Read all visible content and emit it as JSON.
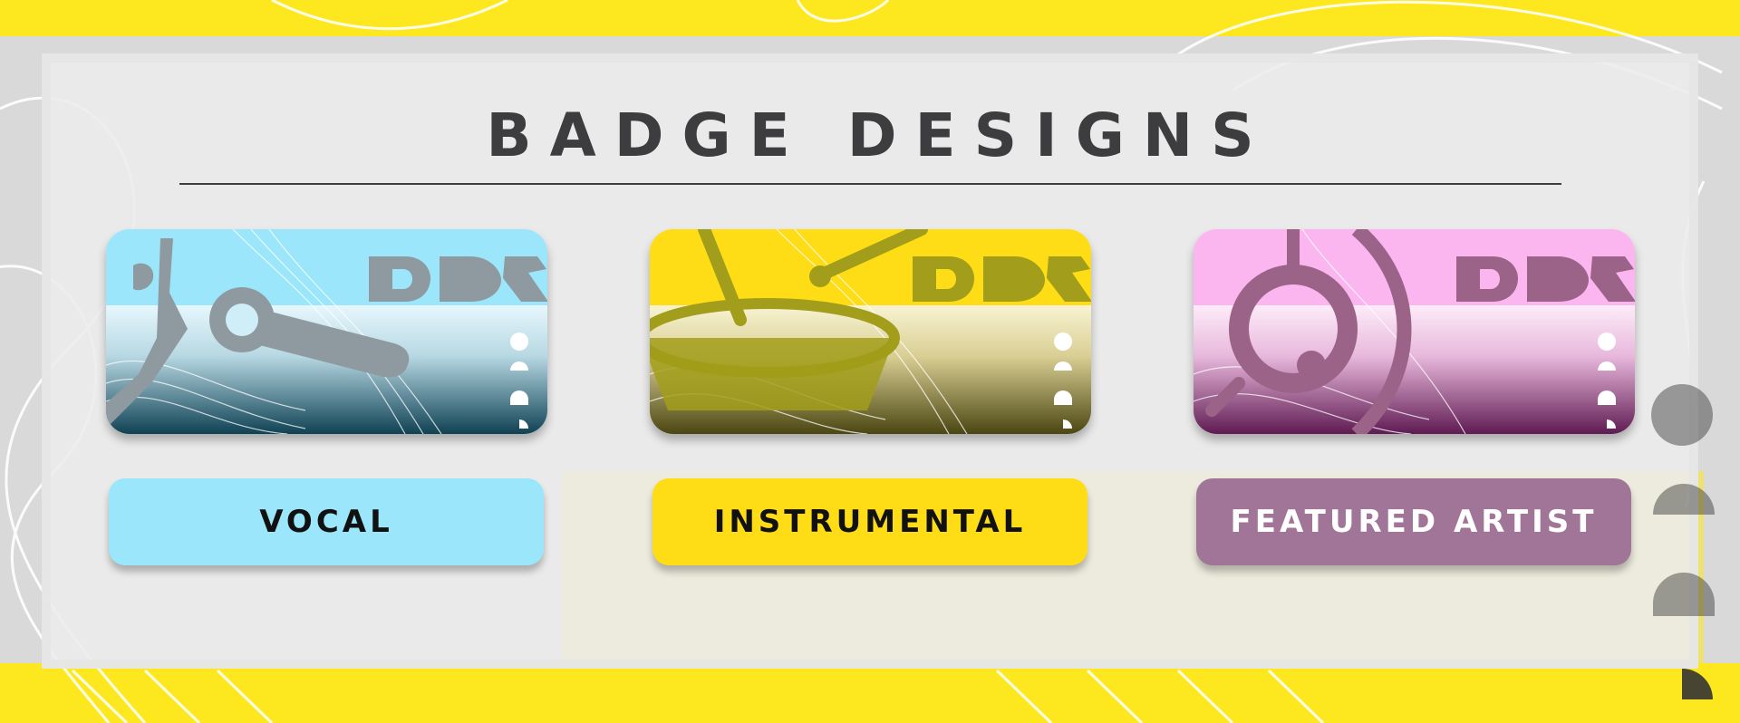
{
  "page": {
    "title": "BADGE DESIGNS"
  },
  "badges": [
    {
      "id": "vocal",
      "label": "VOCAL",
      "icon": "microphone-icon",
      "color": "#9be6fb",
      "ink": "#8e9aa0",
      "dark": "#0f4254"
    },
    {
      "id": "instrumental",
      "label": "INSTRUMENTAL",
      "icon": "drum-icon",
      "color": "#fedd16",
      "ink": "#a29d1a",
      "dark": "#4b4612"
    },
    {
      "id": "featured-artist",
      "label": "FEATURED ARTIST",
      "icon": "record-icon",
      "color": "#fbb6ef",
      "ink": "#9b6387",
      "dark": "#5f1b52"
    }
  ],
  "buttons": {
    "vocal": "VOCAL",
    "instrumental": "INSTRUMENTAL",
    "featured_artist": "FEATURED ARTIST"
  },
  "colors": {
    "background_yellow": "#fde81f",
    "panel": "#ececec",
    "title": "#3d3d3f"
  }
}
